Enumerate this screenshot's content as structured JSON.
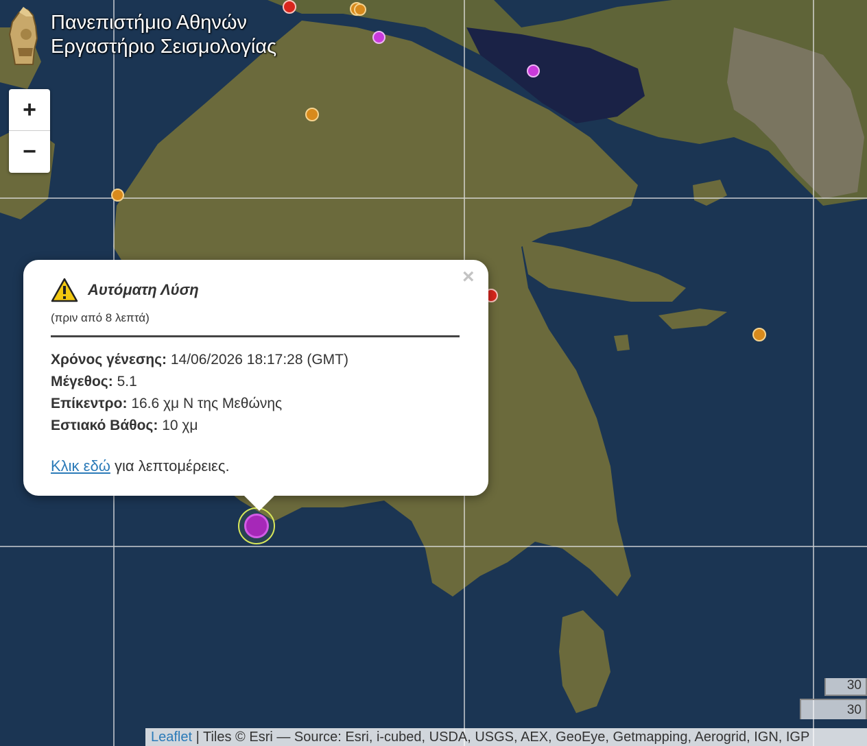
{
  "brand": {
    "line1": "Πανεπιστήμιο Αθηνών",
    "line2": "Εργαστήριο Σεισμολογίας",
    "logo_icon": "athena-helmet-icon"
  },
  "zoom": {
    "in_label": "+",
    "out_label": "−"
  },
  "colors": {
    "sea": "#1b3553",
    "land": "#6b6a3c",
    "marker_orange": "#d88a1c",
    "marker_purple": "#c93adb",
    "marker_red": "#d9261c",
    "selected_ring": "#d8e85a",
    "link": "#2a7ab8"
  },
  "popup": {
    "warning_icon": "warning-triangle-icon",
    "title": "Αυτόματη Λύση",
    "ago": "(πριν από 8 λεπτά)",
    "origin_label": "Χρόνος γένεσης:",
    "origin_value": "14/06/2026 18:17:28 (GMT)",
    "magnitude_label": "Μέγεθος:",
    "magnitude_value": "5.1",
    "epicenter_label": "Επίκεντρο:",
    "epicenter_value": "16.6 χμ N της Μεθώνης",
    "depth_label": "Εστιακό Βάθος:",
    "depth_value": "10 χμ",
    "link_text": "Κλικ εδώ",
    "link_suffix": "για λεπτομέρειες.",
    "close_label": "×"
  },
  "scale": {
    "top_label": "30",
    "bottom_label": "30"
  },
  "attribution": {
    "leaflet": "Leaflet",
    "rest": "| Tiles © Esri — Source: Esri, i-cubed, USDA, USGS, AEX, GeoEye, Getmapping, Aerogrid, IGN, IGP"
  }
}
